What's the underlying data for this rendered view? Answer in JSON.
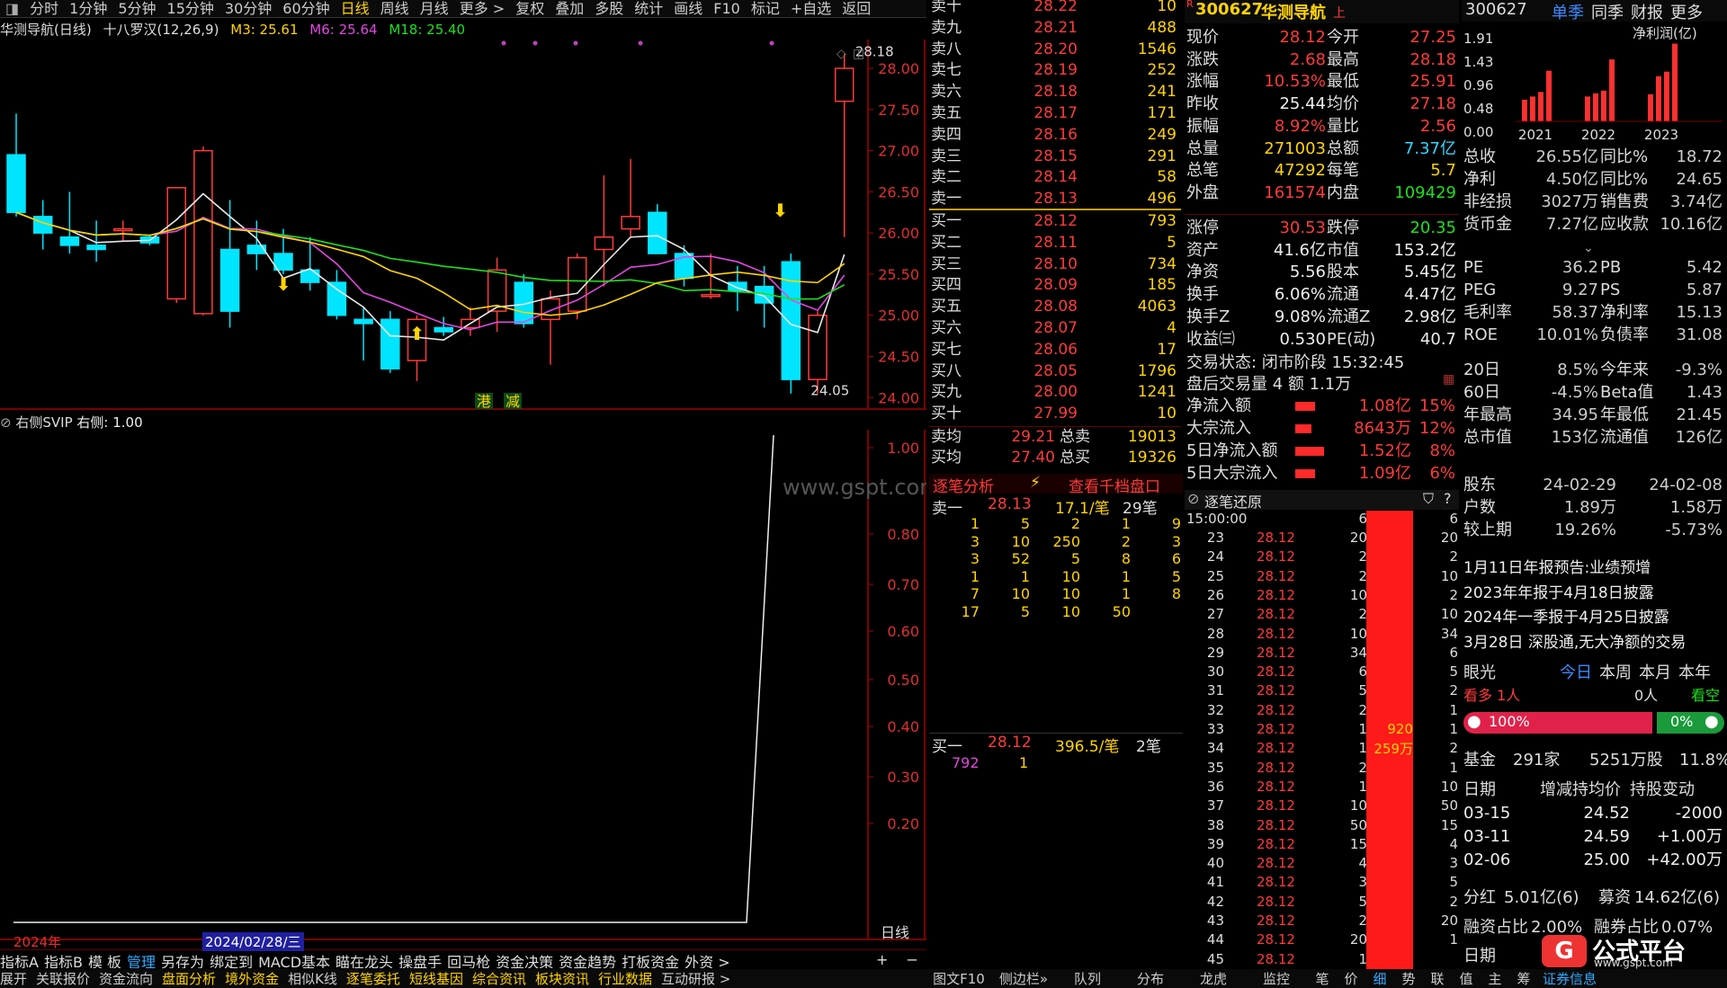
{
  "menu": {
    "items": [
      "分时",
      "1分钟",
      "5分钟",
      "15分钟",
      "30分钟",
      "60分钟",
      "日线",
      "周线",
      "月线",
      "更多 >",
      "复权",
      "叠加",
      "多股",
      "统计",
      "画线",
      "F10",
      "标记",
      "+自选",
      "返回"
    ],
    "active": "日线"
  },
  "chart": {
    "stock_name": "华测导航(日线)",
    "indicator": "十八罗汉(12,26,9)",
    "m3": "M3: 25.61",
    "m6": "M6: 25.64",
    "m18": "M18: 25.40",
    "high_label": "28.18",
    "low_label": "24.05",
    "price_axis": [
      "28.00",
      "27.50",
      "27.00",
      "26.50",
      "26.00",
      "25.50",
      "25.00",
      "24.50",
      "24.00"
    ],
    "ymin": 23.85,
    "ymax": 28.35,
    "markers": [
      "港",
      "减"
    ],
    "candles": [
      [
        26.95,
        27.45,
        26.2,
        26.25
      ],
      [
        26.2,
        26.4,
        25.8,
        26.0
      ],
      [
        25.95,
        26.5,
        25.75,
        25.85
      ],
      [
        25.85,
        26.15,
        25.65,
        25.8
      ],
      [
        26.05,
        26.15,
        25.9,
        26.05
      ],
      [
        25.95,
        25.98,
        25.85,
        25.88
      ],
      [
        25.2,
        26.55,
        25.15,
        26.55
      ],
      [
        25.02,
        27.05,
        25.0,
        27.0
      ],
      [
        25.8,
        26.4,
        24.85,
        25.05
      ],
      [
        25.85,
        26.15,
        25.55,
        25.75
      ],
      [
        25.75,
        26.05,
        25.5,
        25.55
      ],
      [
        25.55,
        25.95,
        25.3,
        25.4
      ],
      [
        25.4,
        25.55,
        24.95,
        25.0
      ],
      [
        24.95,
        25.1,
        24.45,
        24.9
      ],
      [
        24.95,
        25.05,
        24.3,
        24.35
      ],
      [
        24.45,
        25.0,
        24.2,
        24.95
      ],
      [
        24.85,
        24.98,
        24.75,
        24.8
      ],
      [
        24.85,
        25.1,
        24.75,
        24.95
      ],
      [
        25.05,
        25.7,
        24.8,
        25.55
      ],
      [
        25.4,
        25.5,
        24.85,
        24.9
      ],
      [
        24.95,
        25.3,
        24.4,
        25.2
      ],
      [
        25.05,
        25.75,
        24.95,
        25.7
      ],
      [
        25.8,
        26.7,
        25.35,
        25.95
      ],
      [
        26.05,
        26.9,
        25.95,
        26.2
      ],
      [
        26.25,
        26.35,
        25.75,
        25.75
      ],
      [
        25.75,
        25.85,
        25.35,
        25.45
      ],
      [
        25.25,
        25.75,
        25.2,
        25.25
      ],
      [
        25.4,
        25.6,
        25.05,
        25.3
      ],
      [
        25.35,
        25.6,
        24.85,
        25.15
      ],
      [
        25.65,
        25.75,
        24.05,
        24.22
      ],
      [
        24.22,
        25.05,
        24.05,
        25.0
      ],
      [
        27.6,
        28.18,
        25.95,
        28.0
      ]
    ]
  },
  "indicator_panel": {
    "title": "右侧SVIP",
    "param": "右侧: 1.00",
    "axis": [
      "1.00",
      "0.80",
      "0.70",
      "0.60",
      "0.50",
      "0.40",
      "0.30",
      "0.20"
    ],
    "period_label": "日线",
    "watermark": "www.gspt.com"
  },
  "date_bar": {
    "year": "2024年",
    "cursor_date": "2024/02/28/三"
  },
  "bottom_tabs1": [
    "指标A",
    "指标B",
    "模 板",
    "管理",
    "另存为",
    "绑定到",
    "MACD基本",
    "瞄在龙头",
    "操盘手",
    "回马枪",
    "资金决策",
    "资金趋势",
    "打板资金",
    "外资 >"
  ],
  "bottom_tabs2": [
    "展开",
    "关联报价",
    "资金流向",
    "盘面分析",
    "境外资金",
    "相似K线",
    "逐笔委托",
    "短线基因",
    "综合资讯",
    "板块资讯",
    "行业数据",
    "互动研报 >"
  ],
  "right_bottom_tabs": [
    "图文F10",
    "侧边栏»",
    "队列",
    "分布",
    "龙虎",
    "监控",
    "笔",
    "价",
    "细",
    "势",
    "联",
    "值",
    "主",
    "筹",
    "证券信息"
  ],
  "orderbook": {
    "sell": [
      [
        "卖十",
        "28.22",
        "10"
      ],
      [
        "卖九",
        "28.21",
        "488"
      ],
      [
        "卖八",
        "28.20",
        "1546"
      ],
      [
        "卖七",
        "28.19",
        "252"
      ],
      [
        "卖六",
        "28.18",
        "241"
      ],
      [
        "卖五",
        "28.17",
        "171"
      ],
      [
        "卖四",
        "28.16",
        "249"
      ],
      [
        "卖三",
        "28.15",
        "291"
      ],
      [
        "卖二",
        "28.14",
        "58"
      ],
      [
        "卖一",
        "28.13",
        "496"
      ]
    ],
    "buy": [
      [
        "买一",
        "28.12",
        "793"
      ],
      [
        "买二",
        "28.11",
        "5"
      ],
      [
        "买三",
        "28.10",
        "734"
      ],
      [
        "买四",
        "28.09",
        "185"
      ],
      [
        "买五",
        "28.08",
        "4063"
      ],
      [
        "买六",
        "28.07",
        "4"
      ],
      [
        "买七",
        "28.06",
        "17"
      ],
      [
        "买八",
        "28.05",
        "1796"
      ],
      [
        "买九",
        "28.00",
        "1241"
      ],
      [
        "买十",
        "27.99",
        "10"
      ]
    ],
    "avg": [
      [
        "卖均",
        "29.21",
        "总卖",
        "19013"
      ],
      [
        "买均",
        "27.40",
        "总买",
        "19326"
      ]
    ]
  },
  "trades": {
    "header": [
      "逐笔分析",
      "查看千档盘口"
    ],
    "sell1": [
      "卖一",
      "28.13",
      "17.1/笔",
      "29笔"
    ],
    "rows": [
      [
        "1",
        "5",
        "2",
        "1",
        "9"
      ],
      [
        "3",
        "10",
        "250",
        "2",
        "3"
      ],
      [
        "3",
        "52",
        "5",
        "8",
        "6"
      ],
      [
        "1",
        "1",
        "10",
        "1",
        "5"
      ],
      [
        "7",
        "10",
        "10",
        "1",
        "8"
      ],
      [
        "17",
        "5",
        "10",
        "50",
        ""
      ]
    ],
    "buy1": [
      "买一",
      "28.12",
      "396.5/笔",
      "2笔"
    ],
    "buy1_detail": [
      "792",
      "1"
    ]
  },
  "quote": {
    "code": "300627",
    "name": "华测导航",
    "tag": "上",
    "rows": [
      [
        "现价",
        "28.12",
        "今开",
        "27.25"
      ],
      [
        "涨跌",
        "2.68",
        "最高",
        "28.18"
      ],
      [
        "涨幅",
        "10.53%",
        "最低",
        "25.91"
      ],
      [
        "昨收",
        "25.44",
        "均价",
        "27.18"
      ],
      [
        "振幅",
        "8.92%",
        "量比",
        "2.56"
      ],
      [
        "总量",
        "271003",
        "总额",
        "7.37亿"
      ],
      [
        "总笔",
        "47292",
        "每笔",
        "5.7"
      ],
      [
        "外盘",
        "161574",
        "内盘",
        "109429"
      ],
      [
        "涨停",
        "30.53",
        "跌停",
        "20.35"
      ],
      [
        "资产",
        "41.6亿",
        "市值",
        "153.2亿"
      ],
      [
        "净资",
        "5.56",
        "股本",
        "5.45亿"
      ],
      [
        "换手",
        "6.06%",
        "流通",
        "4.47亿"
      ],
      [
        "换手Z",
        "9.08%",
        "流通Z",
        "2.98亿"
      ],
      [
        "收益㈢",
        "0.530",
        "PE(动)",
        "40.7"
      ]
    ],
    "status": "交易状态: 闭市阶段 15:32:45",
    "after": "盘后交易量 4 额 1.1万",
    "flows": [
      [
        "净流入额",
        "1.08亿",
        "15%"
      ],
      [
        "大宗流入",
        "8643万",
        "12%"
      ],
      [
        "5日净流入额",
        "1.52亿",
        "8%"
      ],
      [
        "5日大宗流入",
        "1.09亿",
        "6%"
      ]
    ]
  },
  "ticks": {
    "title": "逐笔还原",
    "start": "15:00:00",
    "rows": [
      [
        "23",
        "28.12",
        "20",
        "20"
      ],
      [
        "24",
        "28.12",
        "2",
        "2"
      ],
      [
        "25",
        "28.12",
        "2",
        "10"
      ],
      [
        "26",
        "28.12",
        "10",
        "2"
      ],
      [
        "27",
        "28.12",
        "2",
        "10"
      ],
      [
        "28",
        "28.12",
        "10",
        "34"
      ],
      [
        "29",
        "28.12",
        "34",
        "6"
      ],
      [
        "30",
        "28.12",
        "6",
        "5"
      ],
      [
        "31",
        "28.12",
        "5",
        "2"
      ],
      [
        "32",
        "28.12",
        "2",
        "1"
      ],
      [
        "33",
        "28.12",
        "1",
        "1"
      ],
      [
        "34",
        "28.12",
        "1",
        "2"
      ],
      [
        "35",
        "28.12",
        "2",
        "1"
      ],
      [
        "36",
        "28.12",
        "1",
        "10"
      ],
      [
        "37",
        "28.12",
        "10",
        "50"
      ],
      [
        "38",
        "28.12",
        "50",
        "15"
      ],
      [
        "39",
        "28.12",
        "15",
        "4"
      ],
      [
        "40",
        "28.12",
        "4",
        "3"
      ],
      [
        "41",
        "28.12",
        "3",
        "5"
      ],
      [
        "42",
        "28.12",
        "5",
        "2"
      ],
      [
        "43",
        "28.12",
        "2",
        "20"
      ],
      [
        "44",
        "28.12",
        "20",
        "1"
      ],
      [
        "45",
        "28.12",
        "1",
        ""
      ]
    ],
    "first_vol": "6",
    "first_right": "6",
    "bar_label1": "920",
    "bar_label2": "259万"
  },
  "fund": {
    "code": "300627",
    "tabs": [
      "单季",
      "同季",
      "财报",
      "更多"
    ],
    "chart_title": "净利润(亿)",
    "yaxis": [
      "1.91",
      "1.43",
      "0.96",
      "0.48",
      "0.00"
    ],
    "years": [
      "2021",
      "2022",
      "2023"
    ],
    "chart_data": {
      "type": "bar",
      "categories": [
        "2021",
        "2021",
        "2021",
        "2021",
        "2022",
        "2022",
        "2022",
        "2022",
        "2023",
        "2023",
        "2023",
        "2023"
      ],
      "values": [
        0.48,
        0.55,
        0.65,
        1.12,
        0.55,
        0.62,
        0.68,
        1.37,
        0.6,
        1.0,
        1.1,
        1.72
      ],
      "ylim": [
        0,
        1.91
      ]
    },
    "rows": [
      [
        "总收",
        "26.55亿",
        "同比%",
        "18.72"
      ],
      [
        "净利",
        "4.50亿",
        "同比%",
        "24.65"
      ],
      [
        "非经损",
        "3027万",
        "销售费",
        "3.74亿"
      ],
      [
        "货币金",
        "7.27亿",
        "应收款",
        "10.16亿"
      ],
      [
        "PE",
        "36.2",
        "PB",
        "5.42"
      ],
      [
        "PEG",
        "9.27",
        "PS",
        "5.87"
      ],
      [
        "毛利率",
        "58.37",
        "净利率",
        "15.13"
      ],
      [
        "ROE",
        "10.01%",
        "负债率",
        "31.08"
      ],
      [
        "20日",
        "8.5%",
        "今年来",
        "-9.3%"
      ],
      [
        "60日",
        "-4.5%",
        "Beta值",
        "1.43"
      ],
      [
        "年最高",
        "34.95",
        "年最低",
        "21.45"
      ],
      [
        "总市值",
        "153亿",
        "流通值",
        "126亿"
      ]
    ],
    "holders": [
      [
        "股东",
        "24-02-29",
        "24-02-08"
      ],
      [
        "户数",
        "1.89万",
        "1.58万"
      ],
      [
        "较上期",
        "19.26%",
        "-5.73%"
      ]
    ],
    "news": [
      "1月11日年报预告:业绩预增",
      "2023年年报于4月18日披露",
      "2024年一季报于4月25日披露",
      "3月28日 深股通,无大净额的交易"
    ],
    "eye": {
      "label": "眼光",
      "tabs": [
        "今日",
        "本周",
        "本月",
        "本年"
      ],
      "bull": "看多 1人",
      "bear": "0人",
      "bull_label": "看空",
      "pct_bull": "100%",
      "pct_bear": "0%"
    },
    "fund_hold": {
      "label": "基金",
      "count": "291家",
      "shares": "5251万股",
      "pct": "11.8%"
    },
    "trade_hdr": [
      "日期",
      "增减持均价",
      "持股变动"
    ],
    "trades": [
      [
        "03-15",
        "24.52",
        "-2000"
      ],
      [
        "03-11",
        "24.59",
        "+1.00万"
      ],
      [
        "02-06",
        "25.00",
        "+42.00万"
      ]
    ],
    "dividend": [
      "分红",
      "5.01亿(6)",
      "募资",
      "14.62亿(6)"
    ],
    "margin": [
      "融资占比",
      "2.00%",
      "融券占比",
      "0.07%"
    ],
    "last": "日期"
  },
  "logo": {
    "text": "公式平台",
    "url": "www.gspt.com"
  },
  "colors": {
    "up": "#ff3b3b",
    "down": "#00e5ff",
    "ma3": "#e8e8e8",
    "ma6": "#e048e0",
    "ma18": "#1ee01e",
    "ma_yellow": "#ffd400",
    "grid": "#7a0000"
  }
}
